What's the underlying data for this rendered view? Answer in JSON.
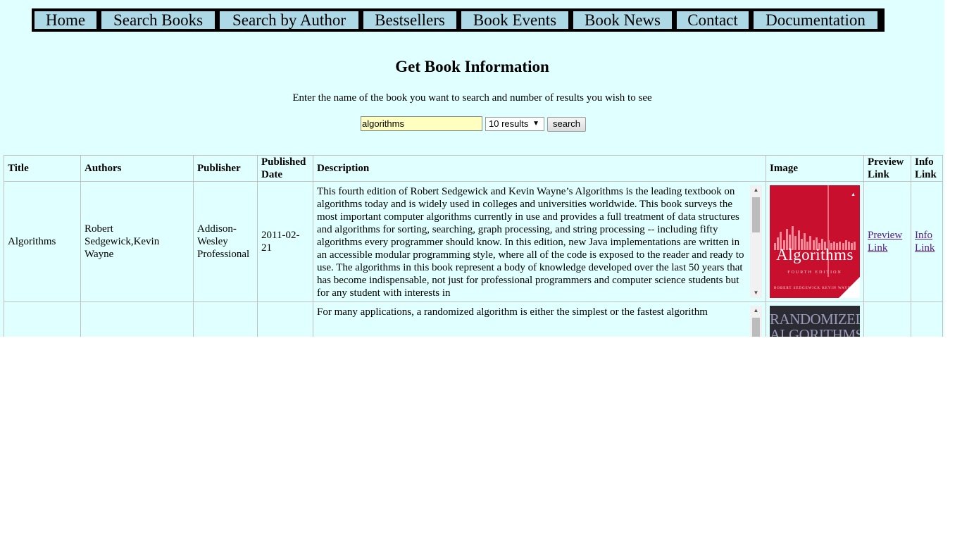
{
  "nav": {
    "items": [
      {
        "label": "Home"
      },
      {
        "label": "Search Books"
      },
      {
        "label": "Search by Author"
      },
      {
        "label": "Bestsellers"
      },
      {
        "label": "Book Events"
      },
      {
        "label": "Book News"
      },
      {
        "label": "Contact"
      },
      {
        "label": "Documentation"
      }
    ]
  },
  "page": {
    "heading": "Get Book Information",
    "instructions": "Enter the name of the book you want to search and number of results you wish to see"
  },
  "search": {
    "query": "algorithms",
    "results_option": "10 results",
    "button_label": "search"
  },
  "table": {
    "headers": [
      "Title",
      "Authors",
      "Publisher",
      "Published Date",
      "Description",
      "Image",
      "Preview Link",
      "Info Link"
    ],
    "rows": [
      {
        "title": "Algorithms",
        "authors": "Robert Sedgewick,Kevin Wayne",
        "publisher": "Addison-Wesley Professional",
        "published_date": "2011-02-21",
        "description": "This fourth edition of Robert Sedgewick and Kevin Wayne’s Algorithms is the leading textbook on algorithms today and is widely used in colleges and universities worldwide. This book surveys the most important computer algorithms currently in use and provides a full treatment of data structures and algorithms for sorting, searching, graph processing, and string processing -- including fifty algorithms every programmer should know. In this edition, new Java implementations are written in an accessible modular programming style, where all of the code is exposed to the reader and ready to use. The algorithms in this book represent a body of knowledge developed over the last 50 years that has become indispensable, not just for professional programmers and computer science students but for any student with interests in",
        "cover": {
          "title": "Algorithms",
          "subtitle": "FOURTH EDITION",
          "author_line": "ROBERT SEDGEWICK   KEVIN WAYNE",
          "color": "#c8102e"
        },
        "preview_link": "Preview Link",
        "info_link": "Info Link"
      },
      {
        "title": "",
        "authors": "",
        "publisher": "",
        "published_date": "",
        "description": "For many applications, a randomized algorithm is either the simplest or the fastest algorithm",
        "cover": {
          "title": "RANDOMIZED ALGORITHMS",
          "color": "#2b2b33"
        },
        "preview_link": "",
        "info_link": ""
      }
    ]
  },
  "colors": {
    "page_background": "#e0ffff",
    "nav_item_background": "#add8e6",
    "search_input_background": "#ffffc0",
    "link_visited": "#551a8b"
  }
}
